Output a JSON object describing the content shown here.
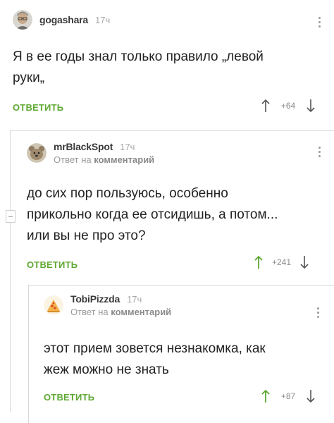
{
  "comments": [
    {
      "username": "gogashara",
      "time": "17ч",
      "reply_prefix": "",
      "reply_target": "",
      "lines": [
        "Я в ее годы знал только правило „левой",
        "руки„"
      ],
      "reply_label": "ОТВЕТИТЬ",
      "score": "+64"
    },
    {
      "username": "mrBlackSpot",
      "time": "17ч",
      "reply_prefix": "Ответ на",
      "reply_target": "комментарий",
      "lines": [
        "до сих пор пользуюсь, особенно",
        "прикольно когда ее отсидишь, а потом...",
        "или вы не про это?"
      ],
      "reply_label": "ОТВЕТИТЬ",
      "score": "+241"
    },
    {
      "username": "TobiPizzda",
      "time": "17ч",
      "reply_prefix": "Ответ на",
      "reply_target": "комментарий",
      "lines": [
        "этот прием зовется незнакомка, как",
        "жеж можно не знать"
      ],
      "reply_label": "ОТВЕТИТЬ",
      "score": "+87"
    }
  ],
  "icons": {
    "upvote": "arrow-up-icon",
    "downvote": "arrow-down-icon",
    "menu": "more-vertical-icon",
    "collapse": "minus-icon"
  },
  "colors": {
    "reply_link": "#5fa832",
    "upvote_active": "#5fa832",
    "vote_neutral": "#8a8a8a"
  }
}
